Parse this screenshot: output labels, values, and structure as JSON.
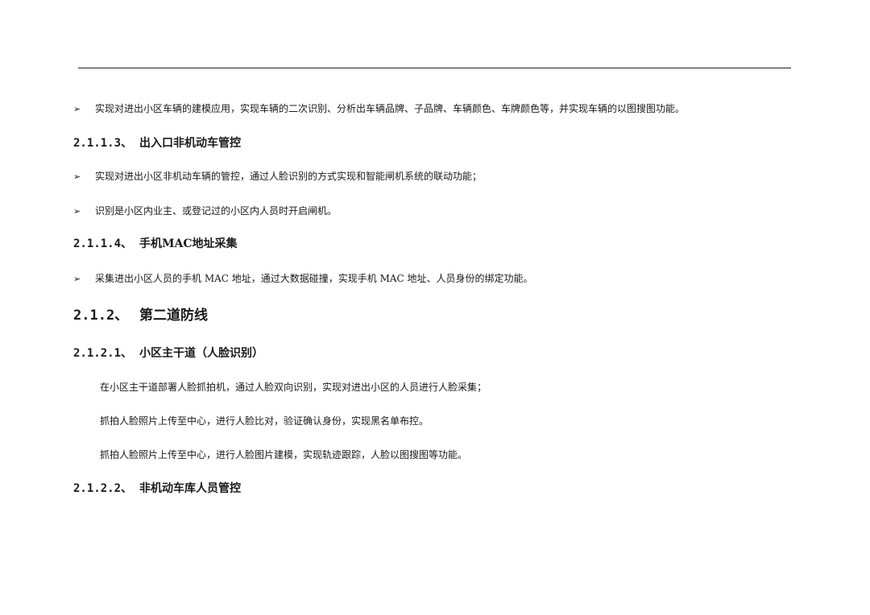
{
  "doc": {
    "bullet_1": "实现对进出小区车辆的建模应用，实现车辆的二次识别、分析出车辆品牌、子品牌、车辆颜色、车牌颜色等，并实现车辆的以图搜图功能。",
    "heading_2113": {
      "num": "2.1.1.3、",
      "title": "出入口非机动车管控"
    },
    "bullet_2": "实现对进出小区非机动车辆的管控，通过人脸识别的方式实现和智能闸机系统的联动功能；",
    "bullet_3": "识别是小区内业主、或登记过的小区内人员时开启闸机。",
    "heading_2114": {
      "num": "2.1.1.4、",
      "title": "手机MAC地址采集"
    },
    "bullet_4": "采集进出小区人员的手机 MAC 地址，通过大数据碰撞，实现手机 MAC 地址、人员身份的绑定功能。",
    "heading_212": {
      "num": "2.1.2、",
      "title": "第二道防线"
    },
    "heading_2121": {
      "num": "2.1.2.1、",
      "title": "小区主干道（人脸识别）"
    },
    "para_1": "在小区主干道部署人脸抓拍机，通过人脸双向识别，实现对进出小区的人员进行人脸采集；",
    "para_2": "抓拍人脸照片上传至中心，进行人脸比对，验证确认身份，实现黑名单布控。",
    "para_3": "抓拍人脸照片上传至中心，进行人脸图片建模，实现轨迹跟踪，人脸以图搜图等功能。",
    "heading_2122": {
      "num": "2.1.2.2、",
      "title": "非机动车库人员管控"
    },
    "bullet_symbol": "➢"
  }
}
